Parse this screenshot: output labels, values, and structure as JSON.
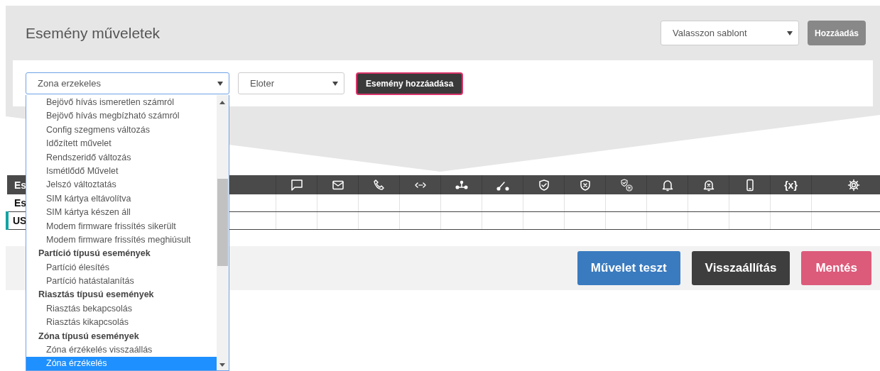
{
  "page_title": "Esemény műveletek",
  "template_select": {
    "value": "Valasszon sablont"
  },
  "add_template_button": {
    "label": "Hozzáadás",
    "disabled": true
  },
  "event_select": {
    "value": "Zona erzekeles",
    "open": true
  },
  "zone_select": {
    "value": "Eloter"
  },
  "add_event_button": {
    "label": "Esemény hozzáadása"
  },
  "event_dropdown": [
    {
      "kind": "option",
      "label": "Bejövő hívás ismeretlen számról",
      "selected": false
    },
    {
      "kind": "option",
      "label": "Bejövő hívás megbízható számról",
      "selected": false
    },
    {
      "kind": "option",
      "label": "Config szegmens változás",
      "selected": false
    },
    {
      "kind": "option",
      "label": "Időzített művelet",
      "selected": false
    },
    {
      "kind": "option",
      "label": "Rendszeridő változás",
      "selected": false
    },
    {
      "kind": "option",
      "label": "Ismétlődő Művelet",
      "selected": false
    },
    {
      "kind": "option",
      "label": "Jelszó változtatás",
      "selected": false
    },
    {
      "kind": "option",
      "label": "SIM kártya eltávolítva",
      "selected": false
    },
    {
      "kind": "option",
      "label": "SIM kártya készen áll",
      "selected": false
    },
    {
      "kind": "option",
      "label": "Modem firmware frissítés sikerült",
      "selected": false
    },
    {
      "kind": "option",
      "label": "Modem firmware frissítés meghiúsult",
      "selected": false
    },
    {
      "kind": "group",
      "label": "Partíció típusú események"
    },
    {
      "kind": "option",
      "label": "Partíció élesítés",
      "selected": false
    },
    {
      "kind": "option",
      "label": "Partíció hatástalanítás",
      "selected": false
    },
    {
      "kind": "group",
      "label": "Riasztás típusú események"
    },
    {
      "kind": "option",
      "label": "Riasztás bekapcsolás",
      "selected": false
    },
    {
      "kind": "option",
      "label": "Riasztás kikapcsolás",
      "selected": false
    },
    {
      "kind": "group",
      "label": "Zóna típusú események"
    },
    {
      "kind": "option",
      "label": "Zóna érzékelés visszaállás",
      "selected": false
    },
    {
      "kind": "option",
      "label": "Zóna érzékelés",
      "selected": true
    }
  ],
  "table": {
    "first_column_header": "Es",
    "variable_column_header": "{x}",
    "rows": [
      {
        "label": "Es",
        "marked": false
      },
      {
        "label": "US",
        "marked": true
      }
    ]
  },
  "actions": [
    {
      "kind": "primary",
      "label": "Művelet teszt"
    },
    {
      "kind": "dark",
      "label": "Visszaállítás"
    },
    {
      "kind": "danger",
      "label": "Mentés"
    }
  ]
}
